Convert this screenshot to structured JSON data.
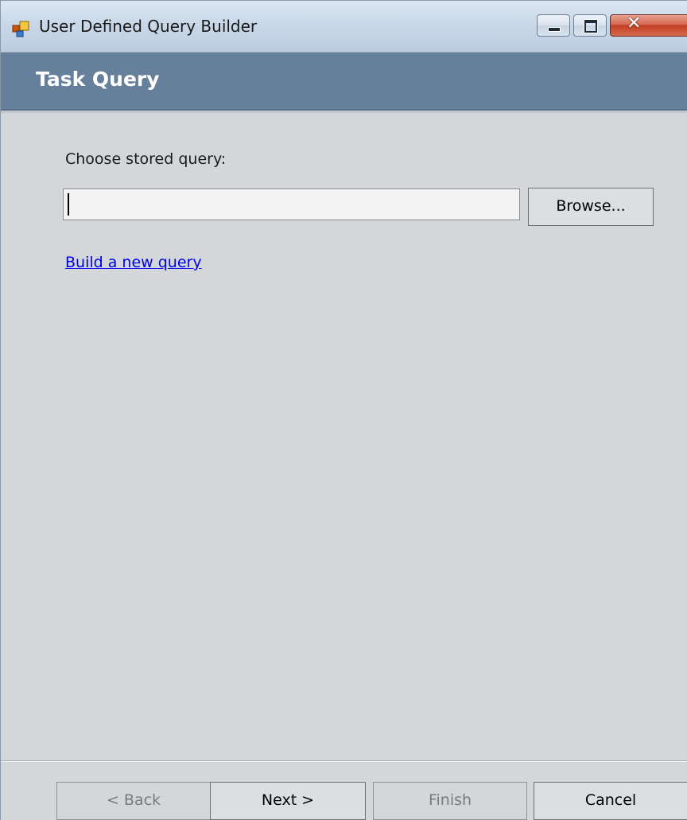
{
  "window": {
    "title": "User Defined Query Builder",
    "icon": "app-window-icon",
    "controls": {
      "minimize": "minimize-icon",
      "maximize": "maximize-icon",
      "close": "close-icon"
    }
  },
  "header": {
    "title": "Task Query",
    "color": "#66809c"
  },
  "form": {
    "label": "Choose stored query:",
    "query_value": "",
    "browse_label": "Browse...",
    "new_query_link": "Build a new query"
  },
  "footer": {
    "back_label": "< Back",
    "next_label": "Next >",
    "finish_label": "Finish",
    "cancel_label": "Cancel",
    "back_enabled": false,
    "finish_enabled": false
  }
}
